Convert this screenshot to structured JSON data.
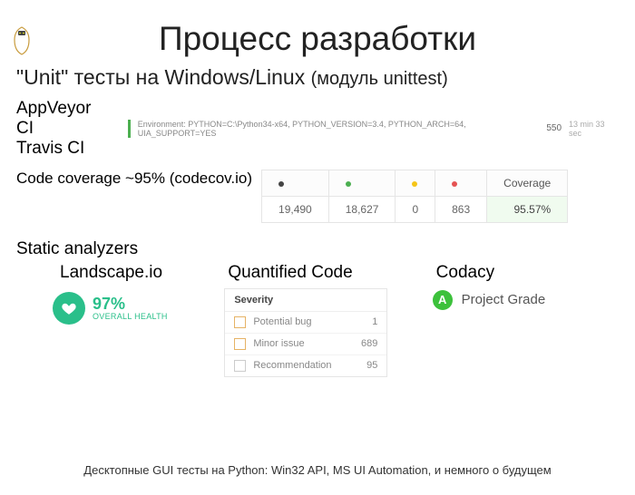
{
  "title": "Процесс разработки",
  "subtitle_pre": "\"Unit\" тесты на Windows/Linux ",
  "subtitle_paren": "(модуль unittest)",
  "ci": {
    "appveyor": "AppVeyor CI",
    "travis": "Travis CI"
  },
  "env": {
    "text": "Environment: PYTHON=C:\\Python34-x64, PYTHON_VERSION=3.4, PYTHON_ARCH=64, UIA_SUPPORT=YES",
    "num": "550",
    "time": "13 min 33 sec"
  },
  "coverage_label": "Code coverage ~95% (codecov.io)",
  "coverage": {
    "head_coverage": "Coverage",
    "c1": "19,490",
    "c2": "18,627",
    "c3": "0",
    "c4": "863",
    "pct": "95.57%"
  },
  "static_title": "Static analyzers",
  "landscape": {
    "title": "Landscape.io",
    "pct": "97%",
    "sub": "OVERALL HEALTH"
  },
  "qc": {
    "title": "Quantified Code",
    "head": "Severity",
    "rows": [
      {
        "label": "Potential bug",
        "num": "1"
      },
      {
        "label": "Minor issue",
        "num": "689"
      },
      {
        "label": "Recommendation",
        "num": "95"
      }
    ]
  },
  "codacy": {
    "title": "Codacy",
    "grade": "A",
    "text": "Project Grade"
  },
  "footer": "Десктопные GUI тесты на Python: Win32 API, MS UI Automation, и немного о будущем"
}
